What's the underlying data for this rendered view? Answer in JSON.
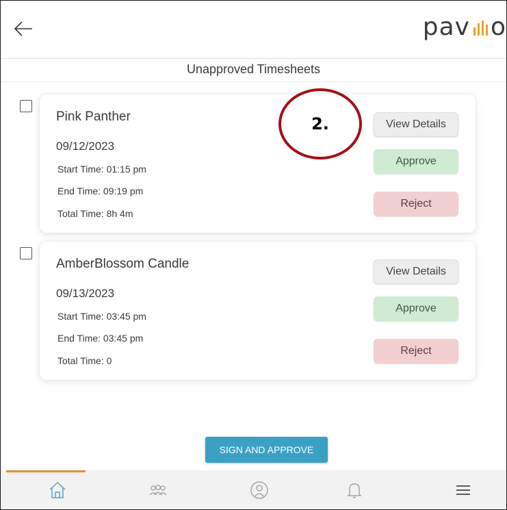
{
  "header": {
    "back_icon": "arrow-left-icon",
    "logo_prefix": "pav",
    "logo_suffix": "o",
    "logo_accent_color": "#e8a233"
  },
  "page": {
    "title": "Unapproved Timesheets"
  },
  "timesheets": [
    {
      "name": "Pink Panther",
      "date": "09/12/2023",
      "start": "Start Time: 01:15 pm",
      "end": "End Time: 09:19 pm",
      "total": "Total Time: 8h 4m",
      "view_label": "View Details",
      "approve_label": "Approve",
      "reject_label": "Reject"
    },
    {
      "name": "AmberBlossom Candle",
      "date": "09/13/2023",
      "start": "Start Time: 03:45 pm",
      "end": "End Time: 03:45 pm",
      "total": "Total Time: 0",
      "view_label": "View Details",
      "approve_label": "Approve",
      "reject_label": "Reject"
    }
  ],
  "annotation": {
    "label": "2.",
    "color": "#a50f14"
  },
  "actions": {
    "sign_and_approve": "SIGN AND APPROVE",
    "color": "#3aa1c4"
  },
  "tabbar": {
    "active_index": 0,
    "active_color": "#e8902a",
    "tabs": [
      "home-icon",
      "team-icon",
      "profile-icon",
      "bell-icon",
      "menu-icon"
    ]
  }
}
